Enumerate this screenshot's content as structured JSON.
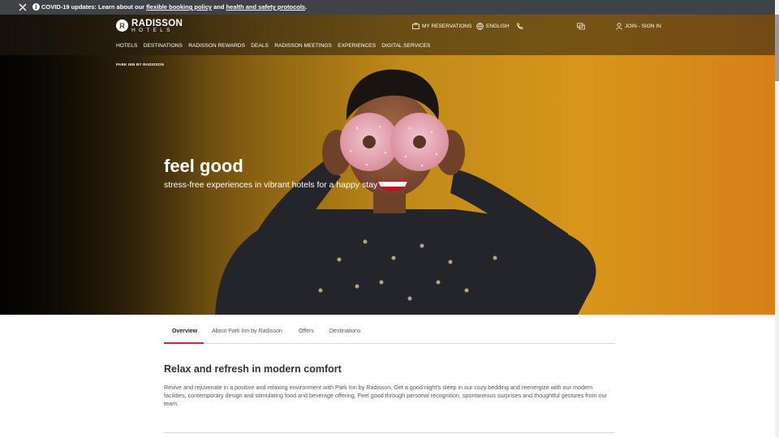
{
  "covid_banner": {
    "prefix": "COVID-19 updates: Learn about our ",
    "link1": "flexible booking policy",
    "middle": " and ",
    "link2": "health and safety protocols",
    "suffix": "."
  },
  "header": {
    "logo_word": "RADISSON",
    "logo_sub": "HOTELS",
    "reservations": "MY RESERVATIONS",
    "language": "ENGLISH",
    "join": "JOIN - SIGN IN"
  },
  "nav": [
    "HOTELS",
    "DESTINATIONS",
    "RADISSON REWARDS",
    "DEALS",
    "RADISSON MEETINGS",
    "EXPERIENCES",
    "DIGITAL SERVICES"
  ],
  "breadcrumb": "PARK INN BY RADISSON",
  "hero": {
    "title": "feel good",
    "subtitle": "stress-free experiences in vibrant hotels for a happy stay"
  },
  "tabs": [
    "Overview",
    "About Park Inn by Radisson",
    "Offers",
    "Destinations"
  ],
  "active_tab": "Overview",
  "section": {
    "title": "Relax and refresh in modern comfort",
    "body": "Revive and rejuvenate in a positive and relaxing environment with Park Inn by Radisson. Get a good night's sleep in our cozy bedding and reenergize with our modern facilities, contemporary design and stimulating food and beverage offering. Feel good through personal recognition, spontaneous surprises and thoughtful gestures from our team."
  },
  "colors": {
    "accent": "#d0252f",
    "banner": "#3f4247",
    "hero_yellow": "#d7961b"
  },
  "icons": [
    "close-icon",
    "info-icon",
    "suitcase-icon",
    "globe-icon",
    "phone-icon",
    "chat-icon",
    "user-icon"
  ]
}
